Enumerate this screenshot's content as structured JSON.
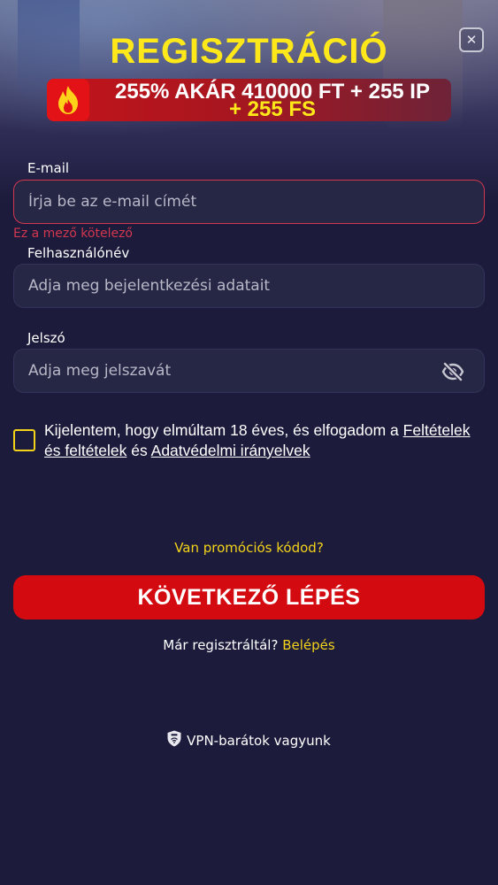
{
  "header": {
    "title": "REGISZTRÁCIÓ",
    "close_icon": "close-icon"
  },
  "bonus": {
    "icon": "fire-icon",
    "line1": "255% AKÁR 410000 FT + 255 IP",
    "line2": "+ 255 FS"
  },
  "form": {
    "email": {
      "label": "E-mail",
      "placeholder": "Írja be az e-mail címét",
      "value": "",
      "error": "Ez a mező kötelező"
    },
    "username": {
      "label": "Felhasználónév",
      "placeholder": "Adja meg bejelentkezési adatait",
      "value": ""
    },
    "password": {
      "label": "Jelszó",
      "placeholder": "Adja meg jelszavát",
      "value": "",
      "toggle_icon": "eye-off-icon"
    },
    "terms": {
      "checked": false,
      "text_before": "Kijelentem, hogy elmúltam 18 éves, és elfogadom a ",
      "link1": "Feltételek és feltételek",
      "text_middle": " és ",
      "link2": "Adatvédelmi irányelvek"
    }
  },
  "promo_link": "Van promóciós kódod?",
  "next_button": "KÖVETKEZŐ LÉPÉS",
  "login": {
    "prompt": "Már regisztráltál?",
    "link": "Belépés"
  },
  "vpn": {
    "icon": "vpn-shield-icon",
    "text": "VPN-barátok vagyunk"
  },
  "colors": {
    "background": "#1c1b3b",
    "accent_yellow": "#ffe81a",
    "primary_red": "#d30b10",
    "error_red": "#d2374f"
  }
}
